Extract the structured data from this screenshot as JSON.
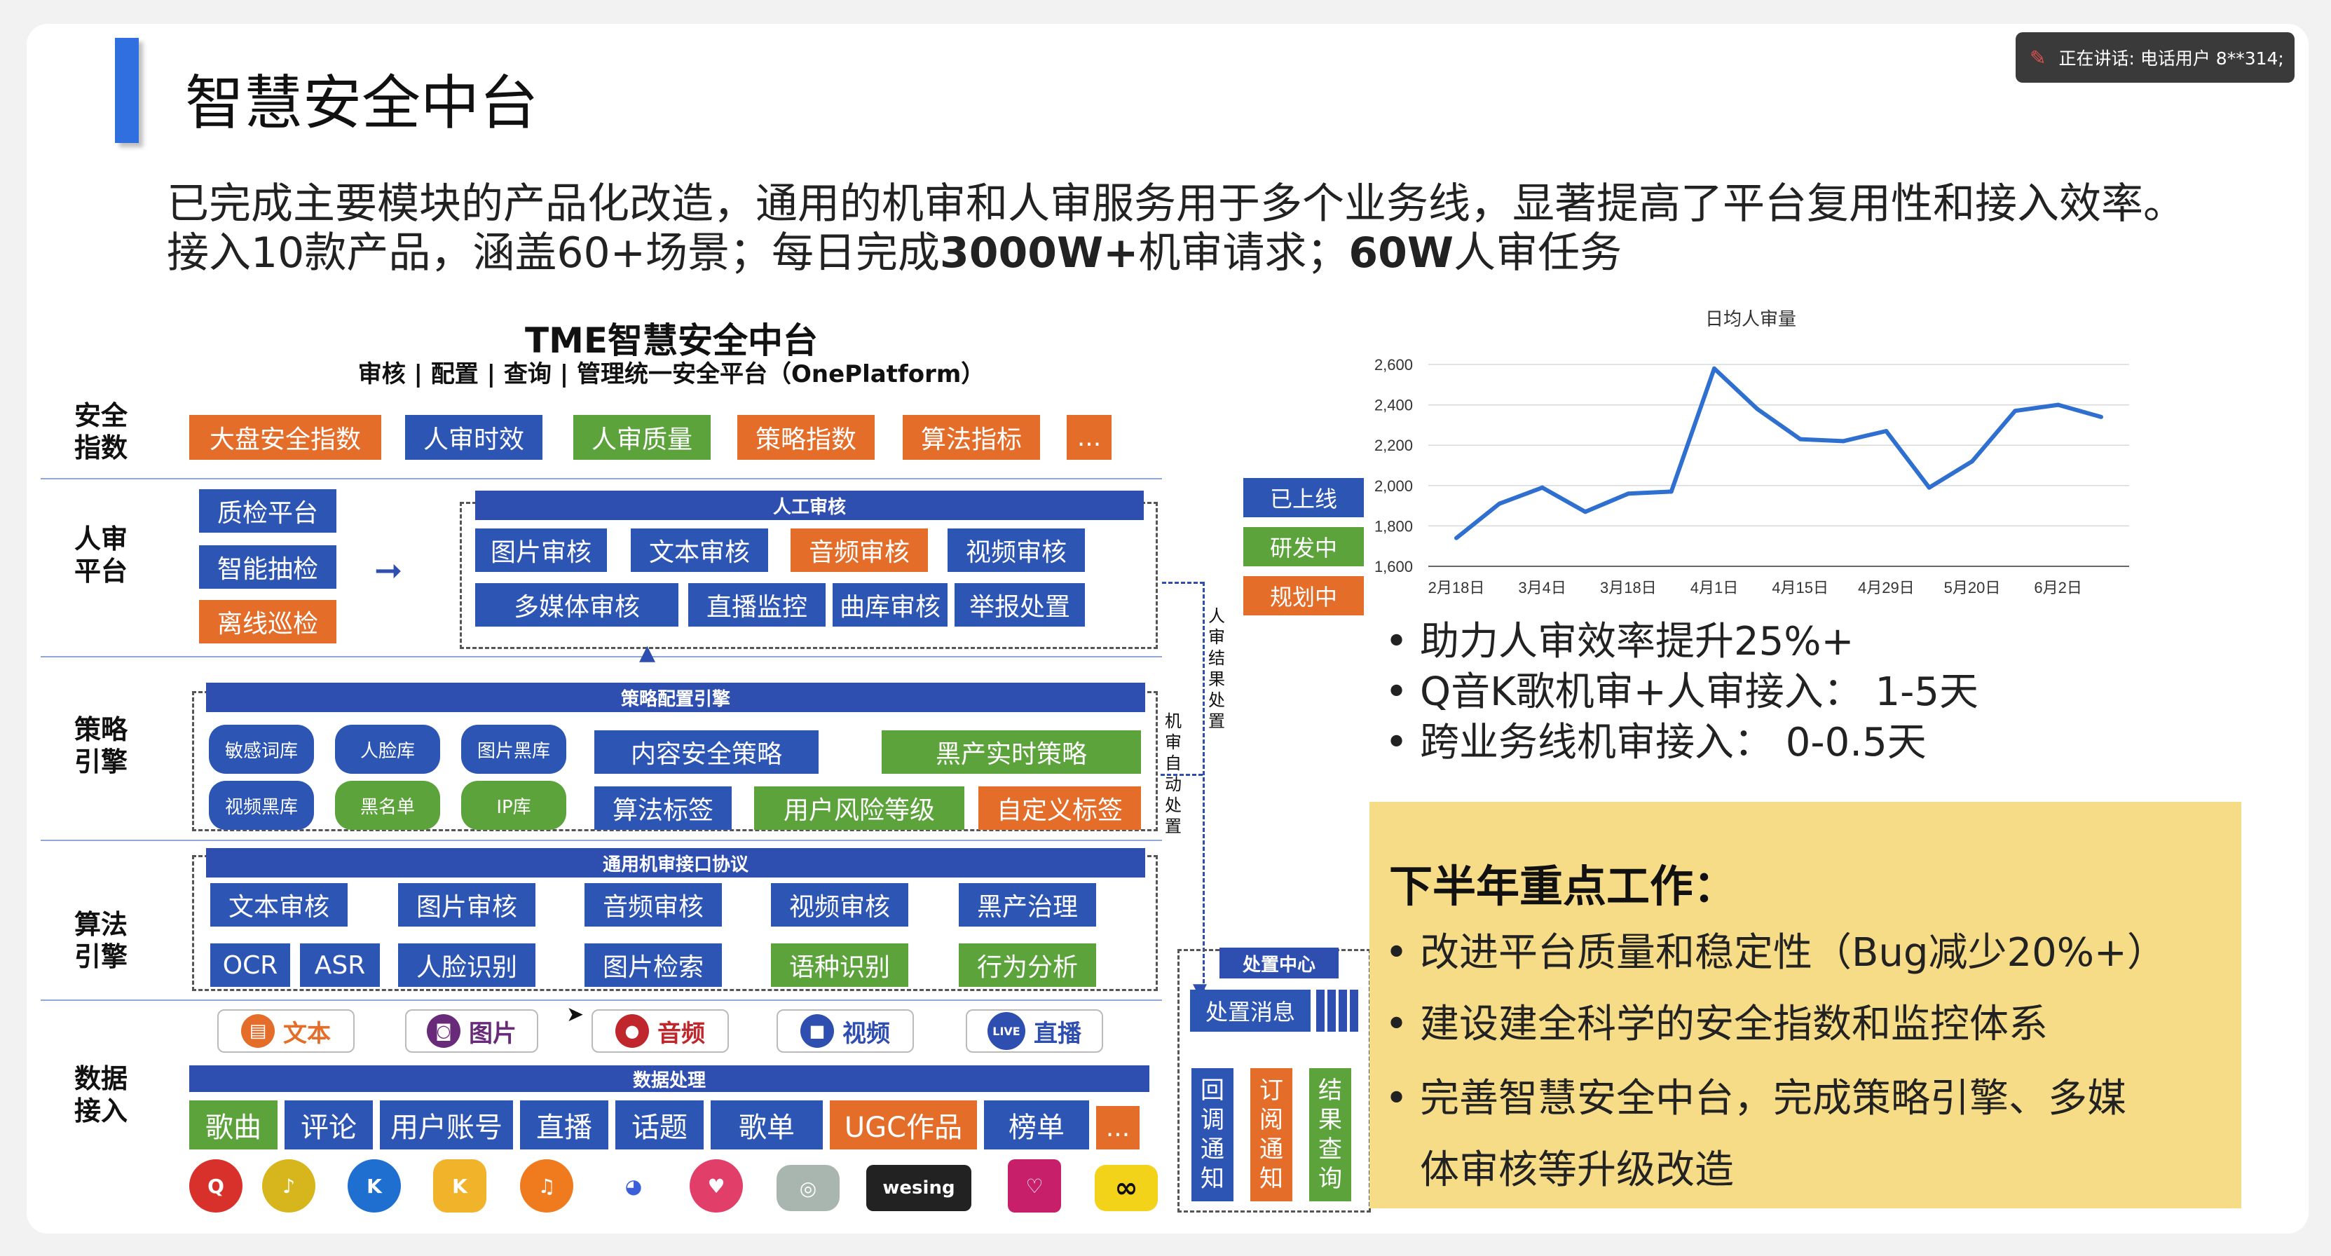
{
  "speaker": {
    "text": "正在讲话: 电话用户 8**314;"
  },
  "title": "智慧安全中台",
  "intro": {
    "line1": "已完成主要模块的产品化改造，通用的机审和人审服务用于多个业务线，显著提高了平台复用性和接入效率。",
    "line2_a": "接入10款产品，涵盖60+场景；每日完成",
    "line2_b": "3000W+",
    "line2_c": "机审请求；",
    "line2_d": "60W",
    "line2_e": "人审任务"
  },
  "arch": {
    "title": "TME智慧安全中台",
    "subtitle": "审核 | 配置 | 查询 | 管理统一安全平台（OnePlatform）",
    "rows": {
      "security": "安全\n指数",
      "human": "人审\n平台",
      "strategy": "策略\n引擎",
      "algo": "算法\n引擎",
      "data": "数据\n接入"
    },
    "security_items": [
      "大盘安全指数",
      "人审时效",
      "人审质量",
      "策略指数",
      "算法指标",
      "..."
    ],
    "human_left": [
      "质检平台",
      "智能抽检",
      "离线巡检"
    ],
    "human_band": "人工审核",
    "human_items": [
      "图片审核",
      "文本审核",
      "音频审核",
      "视频审核",
      "多媒体审核",
      "直播监控",
      "曲库审核",
      "举报处置"
    ],
    "strategy_band": "策略配置引擎",
    "strategy_libs": [
      "敏感词库",
      "人脸库",
      "图片黑库",
      "视频黑库",
      "黑名单",
      "IP库"
    ],
    "strategy_items": [
      "内容安全策略",
      "黑产实时策略",
      "算法标签",
      "用户风险等级",
      "自定义标签"
    ],
    "algo_band": "通用机审接口协议",
    "algo_row1": [
      "文本审核",
      "图片审核",
      "音频审核",
      "视频审核",
      "黑产治理"
    ],
    "algo_row2": [
      "OCR",
      "ASR",
      "人脸识别",
      "图片检索",
      "语种识别",
      "行为分析"
    ],
    "media": [
      "文本",
      "图片",
      "音频",
      "视频",
      "直播"
    ],
    "live_badge": "LIVE",
    "data_band": "数据处理",
    "data_items": [
      "歌曲",
      "评论",
      "用户账号",
      "直播",
      "话题",
      "歌单",
      "UGC作品",
      "榜单",
      "..."
    ],
    "apps": [
      "Q",
      "♪",
      "K",
      "K",
      "♫",
      "◕",
      "♥",
      "◎",
      "wesing",
      "♡",
      "∞"
    ],
    "wesing": "wesing",
    "legend": [
      "已上线",
      "研发中",
      "规划中"
    ],
    "vert_human": "人\n审\n结\n果\n处\n置",
    "vert_machine": "机\n审\n自\n动\n处\n置",
    "dispose_band": "处置中心",
    "dispose_msg": "处置消息",
    "dispose_cols": [
      "回\n调\n通\n知",
      "订\n阅\n通\n知",
      "结\n果\n查\n询"
    ]
  },
  "chart_data": {
    "type": "line",
    "title": "日均人审量",
    "categories": [
      "2月18日",
      "3月4日",
      "3月18日",
      "4月1日",
      "4月15日",
      "4月29日",
      "5月20日",
      "6月2日"
    ],
    "x_positions": [
      "2月18日",
      "",
      "3月4日",
      "",
      "3月18日",
      "",
      "4月1日",
      "",
      "4月15日",
      "",
      "4月29日",
      "",
      "5月20日",
      "",
      "6月2日"
    ],
    "values": [
      1740,
      1910,
      1990,
      1870,
      1960,
      1970,
      2580,
      2380,
      2230,
      2220,
      2270,
      1990,
      2120,
      2370,
      2400,
      2340
    ],
    "ylim": [
      1600,
      2600
    ],
    "yticks": [
      1600,
      1800,
      2000,
      2200,
      2400,
      2600
    ],
    "ytick_labels": [
      "1,600",
      "1,800",
      "2,000",
      "2,200",
      "2,400",
      "2,600"
    ],
    "color": "#2e6fd0"
  },
  "bullets": [
    "助力人审效率提升25%+",
    "Q音K歌机审+人审接入： 1-5天",
    "跨业务线机审接入： 0-0.5天"
  ],
  "plan": {
    "title": "下半年重点工作：",
    "items": [
      "改进平台质量和稳定性（Bug减少20%+）",
      "建设建全科学的安全指数和监控体系",
      "完善智慧安全中台，完成策略引擎、多媒",
      "体审核等升级改造"
    ]
  },
  "colors": {
    "accent": "#2f6fe0",
    "plan_bg": "#f6dc86"
  }
}
